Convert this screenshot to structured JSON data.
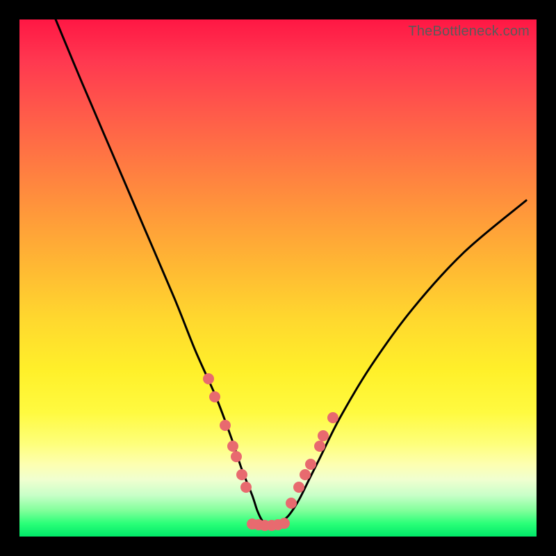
{
  "watermark": "TheBottleneck.com",
  "chart_data": {
    "type": "line",
    "title": "",
    "xlabel": "",
    "ylabel": "",
    "xlim": [
      0,
      100
    ],
    "ylim": [
      0,
      100
    ],
    "curve": {
      "description": "V-shaped bottleneck curve; y = mismatch magnitude, minimum near x≈48",
      "x": [
        7,
        12,
        18,
        24,
        30,
        34,
        38,
        41,
        43,
        45,
        46,
        47,
        48,
        49,
        50,
        52,
        54,
        56,
        58,
        62,
        68,
        76,
        86,
        98
      ],
      "y": [
        100,
        88,
        74,
        60,
        46,
        36,
        27,
        19,
        13,
        8,
        5,
        3,
        2.2,
        2.2,
        2.5,
        4,
        7,
        11,
        15,
        23,
        33,
        44,
        55,
        65
      ]
    },
    "markers_left": {
      "x": [
        36.5,
        37.8,
        39.8,
        41.2,
        41.9,
        43.0,
        43.8
      ],
      "y": [
        30.5,
        27.0,
        21.5,
        17.5,
        15.5,
        12.0,
        9.5
      ]
    },
    "markers_right": {
      "x": [
        52.5,
        54.0,
        55.3,
        56.3,
        58.0,
        58.8,
        60.6
      ],
      "y": [
        6.5,
        9.5,
        12.0,
        14.0,
        17.5,
        19.5,
        23.0
      ]
    },
    "markers_bottom": {
      "x": [
        45.0,
        46.3,
        47.5,
        48.8,
        50.0,
        51.2
      ],
      "y": [
        2.4,
        2.3,
        2.2,
        2.2,
        2.3,
        2.5
      ]
    },
    "colors": {
      "curve": "#000000",
      "marker": "#e86a6f",
      "gradient_top": "#ff1744",
      "gradient_bottom": "#00e868"
    }
  }
}
